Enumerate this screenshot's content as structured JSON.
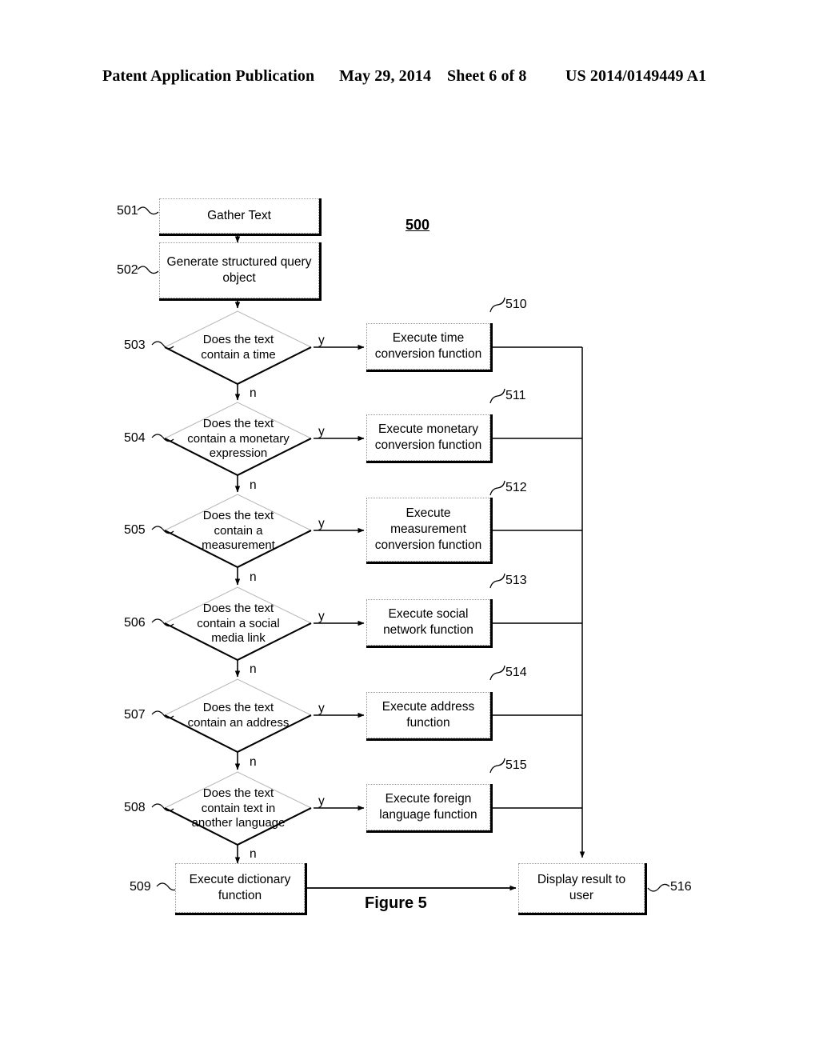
{
  "header": {
    "publication": "Patent Application Publication",
    "date": "May 29, 2014",
    "sheet": "Sheet 6 of 8",
    "patent_number": "US 2014/0149449 A1"
  },
  "figure": {
    "number_label": "500",
    "caption": "Figure 5"
  },
  "process_nodes": [
    {
      "ref": "501",
      "text": "Gather Text"
    },
    {
      "ref": "502",
      "text": "Generate structured query object"
    },
    {
      "ref": "509",
      "text": "Execute dictionary function"
    }
  ],
  "decisions": [
    {
      "ref": "503",
      "text": "Does the text contain a time",
      "yes": "y",
      "no": "n"
    },
    {
      "ref": "504",
      "text": "Does the text contain a monetary expression",
      "yes": "y",
      "no": "n"
    },
    {
      "ref": "505",
      "text": "Does the text contain a measurement",
      "yes": "y",
      "no": "n"
    },
    {
      "ref": "506",
      "text": "Does the text contain a social media link",
      "yes": "y",
      "no": "n"
    },
    {
      "ref": "507",
      "text": "Does the text contain an address",
      "yes": "y",
      "no": "n"
    },
    {
      "ref": "508",
      "text": "Does the text contain text in another language",
      "yes": "y",
      "no": "n"
    }
  ],
  "functions": [
    {
      "ref": "510",
      "text": "Execute time conversion function"
    },
    {
      "ref": "511",
      "text": "Execute monetary conversion function"
    },
    {
      "ref": "512",
      "text": "Execute measurement conversion function"
    },
    {
      "ref": "513",
      "text": "Execute social network function"
    },
    {
      "ref": "514",
      "text": "Execute address function"
    },
    {
      "ref": "515",
      "text": "Execute foreign language function"
    }
  ],
  "terminal": {
    "ref": "516",
    "text": "Display result to user"
  },
  "colors": {
    "ink": "#000000",
    "paper": "#ffffff",
    "node_border": "#9a9a9a"
  }
}
